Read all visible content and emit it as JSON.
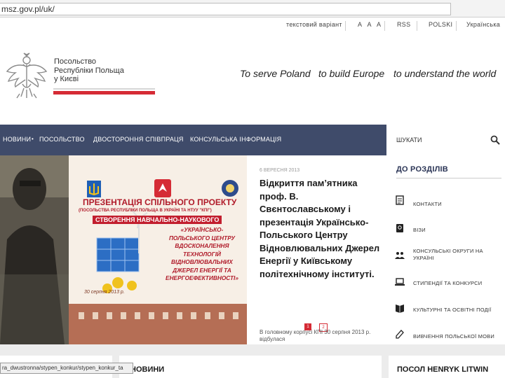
{
  "browser": {
    "url": "msz.gov.pl/uk/"
  },
  "utility_links": [
    "текстовий варіант",
    "A A A",
    "RSS",
    "POLSKI",
    "Українська"
  ],
  "embassy": {
    "name": "Посольство\nРеспубліки Польща\nу Києві"
  },
  "slogans": [
    "To serve Poland",
    "to build Europe",
    "to understand the world"
  ],
  "nav": {
    "items": [
      "НОВИНИ",
      "ПОСОЛЬСТВО",
      "ДВОСТОРОННЯ СПІВПРАЦЯ",
      "КОНСУЛЬСЬКА ІНФОРМАЦІЯ"
    ]
  },
  "search": {
    "label": "ШУКАТИ"
  },
  "banner": {
    "title": "ПРЕЗЕНТАЦІЯ СПІЛЬНОГО ПРОЕКТУ",
    "subtitle": "(ПОСОЛЬСТВА РЕСПУБЛІКИ ПОЛЬЩА В УКРАЇНІ ТА НТУУ \"КПІ\")",
    "line2": "СТВОРЕННЯ НАВЧАЛЬНО-НАУКОВОГО",
    "italic": [
      "«УКРАЇНСЬКО-",
      "ПОЛЬСЬКОГО ЦЕНТРУ",
      "ВДОСКОНАЛЕННЯ",
      "ТЕХНОЛОГІЙ",
      "ВІДНОВЛЮВАЛЬНИХ",
      "ДЖЕРЕЛ ЕНЕРГІЇ ТА",
      "ЕНЕРГОЕФЕКТИВНОСТІ»"
    ],
    "date": "30 серпня 2013 р."
  },
  "article": {
    "date": "6 ВЕРЕСНЯ 2013",
    "headline": "Відкриття пам’ятника проф. В. Свєнтославському і презентація Українсько-Польського Центру Відновлювальних Джерел Енергії у Київському політехнічному інституті.",
    "excerpt": "В головному корпусі КПІ 30 серпня 2013 р. відбулася",
    "pager": [
      "1",
      "2"
    ]
  },
  "sidebar": {
    "title": "ДО РОЗДІЛІВ",
    "items": [
      {
        "label": "КОНТАКТИ",
        "icon": "document-icon"
      },
      {
        "label": "ВІЗИ",
        "icon": "passport-icon"
      },
      {
        "label": "КОНСУЛЬСЬКІ ОКРУГИ НА УКРАЇНІ",
        "icon": "people-icon"
      },
      {
        "label": "СТИПЕНДІЇ ТА КОНКУРСИ",
        "icon": "laptop-icon"
      },
      {
        "label": "КУЛЬТУРНІ ТА ОСВІТНІ ПОДІЇ",
        "icon": "book-icon"
      },
      {
        "label": "ВИВЧЕННЯ ПОЛЬСЬКОЇ МОВИ",
        "icon": "pen-icon"
      }
    ]
  },
  "bottom": {
    "news_title": "НОВИНИ",
    "ambassador_title": "ПОСОЛ HENRYK LITWIN"
  },
  "status_bar": {
    "text": "ra_dwustronna/stypen_konkur/stypen_konkur_ta"
  },
  "colors": {
    "nav": "#3f4b6a",
    "accent_red": "#d52b35",
    "sidebar_title": "#2b3556"
  }
}
